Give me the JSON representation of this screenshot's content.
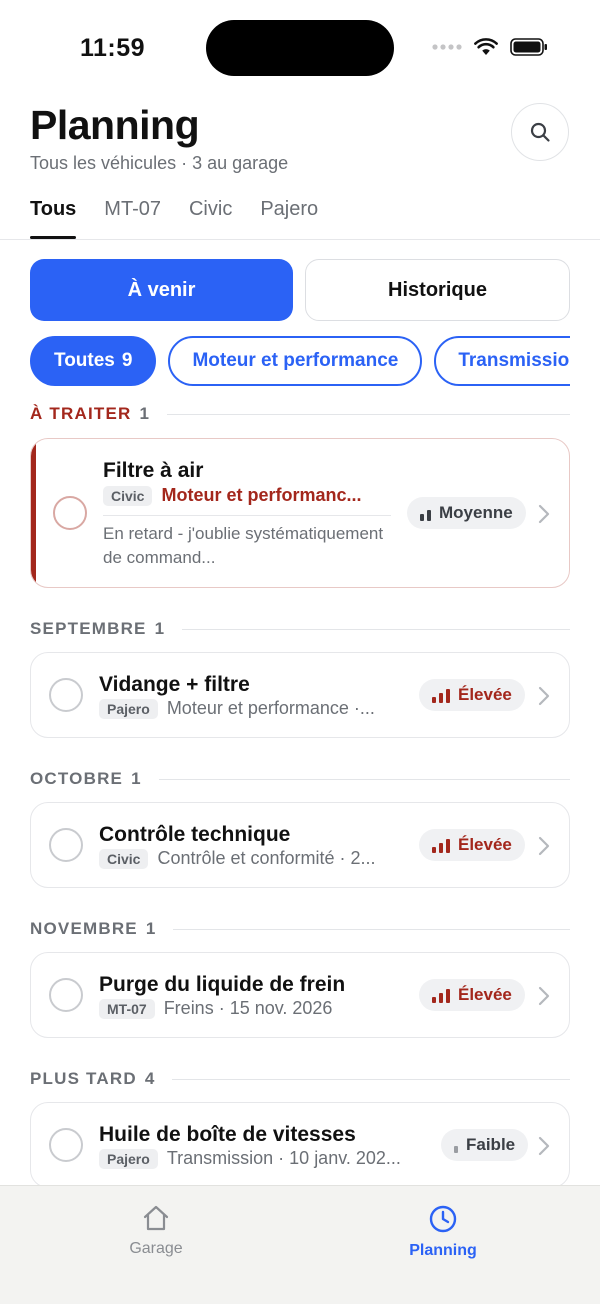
{
  "status_bar": {
    "time": "11:59"
  },
  "header": {
    "title": "Planning",
    "subtitle": "Tous les véhicules · 3 au garage"
  },
  "vehicle_tabs": [
    {
      "label": "Tous",
      "active": true
    },
    {
      "label": "MT-07",
      "active": false
    },
    {
      "label": "Civic",
      "active": false
    },
    {
      "label": "Pajero",
      "active": false
    }
  ],
  "segment": {
    "upcoming": "À venir",
    "history": "Historique",
    "active": "upcoming"
  },
  "category_chips": [
    {
      "label": "Toutes",
      "count": "9",
      "active": true
    },
    {
      "label": "Moteur et performance",
      "active": false
    },
    {
      "label": "Transmission",
      "active": false
    }
  ],
  "sections": [
    {
      "title": "À TRAITER",
      "count": "1",
      "alert": true,
      "tasks": [
        {
          "title": "Filtre à air",
          "vehicle": "Civic",
          "meta": "Moteur et performanc...",
          "note": "En retard - j'oublie systématiquement de command...",
          "priority": "Moyenne",
          "priority_level": 2,
          "overdue": true
        }
      ]
    },
    {
      "title": "SEPTEMBRE",
      "count": "1",
      "tasks": [
        {
          "title": "Vidange + filtre",
          "vehicle": "Pajero",
          "meta": "Moteur et performance ·...",
          "priority": "Élevée",
          "priority_level": 3
        }
      ]
    },
    {
      "title": "OCTOBRE",
      "count": "1",
      "tasks": [
        {
          "title": "Contrôle technique",
          "vehicle": "Civic",
          "meta": "Contrôle et conformité · 2...",
          "priority": "Élevée",
          "priority_level": 3
        }
      ]
    },
    {
      "title": "NOVEMBRE",
      "count": "1",
      "tasks": [
        {
          "title": "Purge du liquide de frein",
          "vehicle": "MT-07",
          "meta": "Freins · 15 nov. 2026",
          "priority": "Élevée",
          "priority_level": 3
        }
      ]
    },
    {
      "title": "PLUS TARD",
      "count": "4",
      "tasks": [
        {
          "title": "Huile de boîte de vitesses",
          "vehicle": "Pajero",
          "meta": "Transmission · 10 janv. 202...",
          "priority": "Faible",
          "priority_level": 1
        }
      ]
    }
  ],
  "tab_bar": {
    "items": [
      {
        "label": "Garage",
        "icon": "house-icon",
        "active": false
      },
      {
        "label": "Planning",
        "icon": "clock-icon",
        "active": true
      }
    ]
  },
  "colors": {
    "accent": "#2b62f5",
    "alert": "#a3271c",
    "muted": "#6b6f75"
  }
}
